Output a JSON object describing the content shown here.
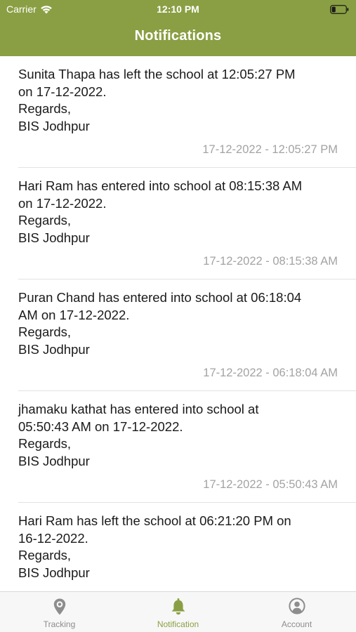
{
  "status_bar": {
    "carrier": "Carrier",
    "time": "12:10 PM"
  },
  "header": {
    "title": "Notifications",
    "color": "#8a9f43"
  },
  "notifications": [
    {
      "message_lines": [
        "Sunita Thapa has left the school at 12:05:27 PM",
        "on 17-12-2022.",
        "Regards,",
        "BIS Jodhpur"
      ],
      "timestamp": "17-12-2022 - 12:05:27 PM"
    },
    {
      "message_lines": [
        "Hari Ram has entered into school at 08:15:38 AM",
        "on 17-12-2022.",
        "Regards,",
        "BIS Jodhpur"
      ],
      "timestamp": "17-12-2022 - 08:15:38 AM"
    },
    {
      "message_lines": [
        "Puran Chand has entered into school at 06:18:04",
        "AM on 17-12-2022.",
        "Regards,",
        "BIS Jodhpur"
      ],
      "timestamp": "17-12-2022 - 06:18:04 AM"
    },
    {
      "message_lines": [
        "jhamaku kathat has entered into school at",
        "05:50:43 AM on 17-12-2022.",
        "Regards,",
        "BIS Jodhpur"
      ],
      "timestamp": "17-12-2022 - 05:50:43 AM"
    },
    {
      "message_lines": [
        "Hari Ram has left the school at 06:21:20 PM on",
        "16-12-2022.",
        "Regards,",
        "BIS Jodhpur"
      ],
      "timestamp": ""
    }
  ],
  "tabbar": {
    "tabs": [
      {
        "label": "Tracking",
        "icon": "location-pin-icon",
        "active": false
      },
      {
        "label": "Notification",
        "icon": "bell-icon",
        "active": true
      },
      {
        "label": "Account",
        "icon": "user-icon",
        "active": false
      }
    ],
    "active_color": "#8a9f43",
    "inactive_color": "#8d8d8d"
  }
}
